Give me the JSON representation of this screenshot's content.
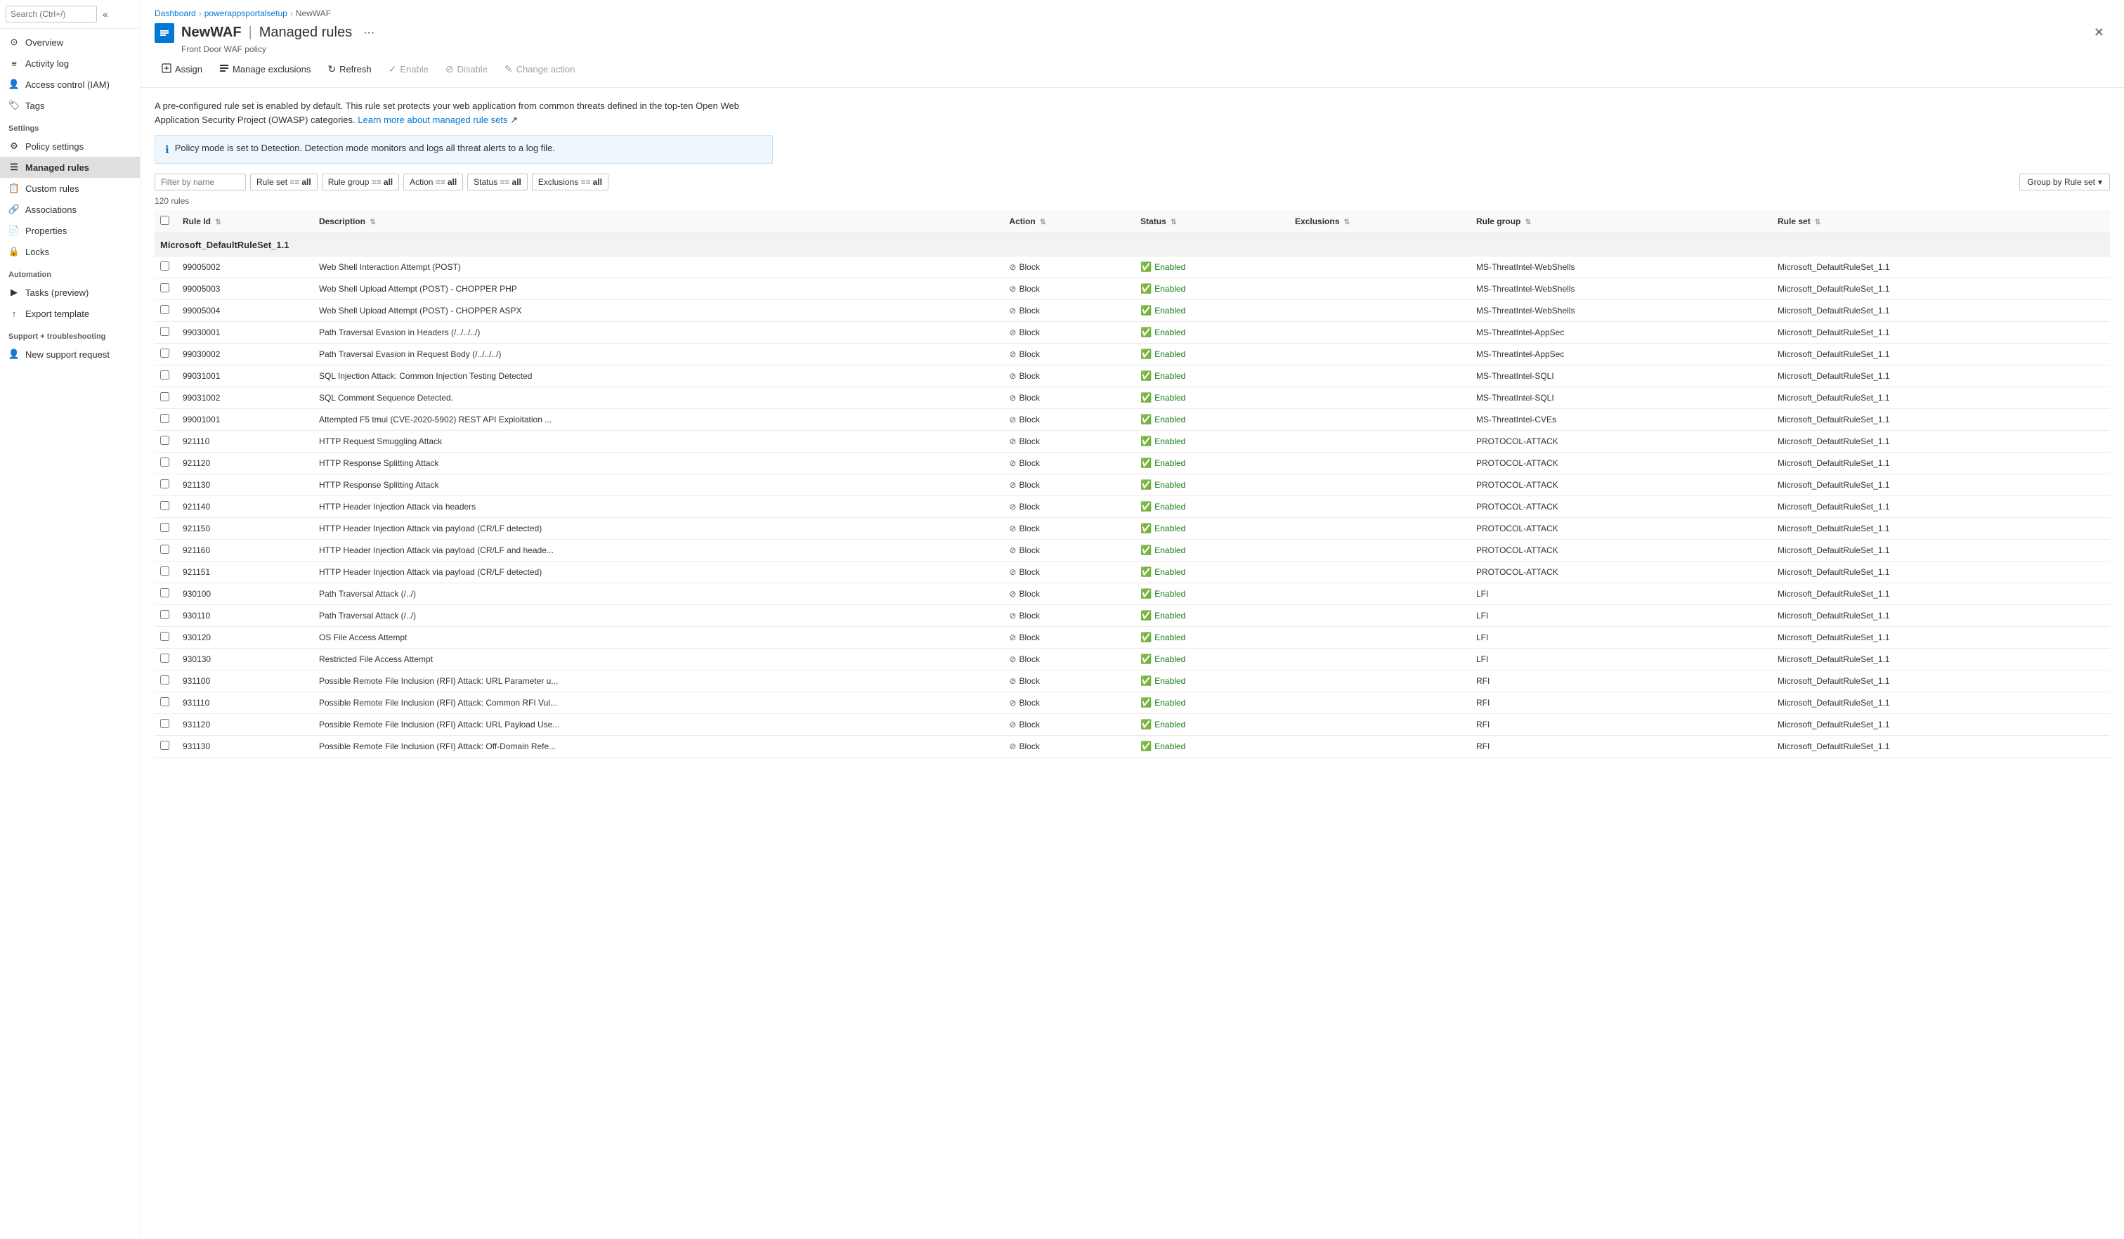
{
  "breadcrumb": {
    "items": [
      {
        "label": "Dashboard",
        "href": "#"
      },
      {
        "label": "powerappsportalsetup",
        "href": "#"
      },
      {
        "label": "NewWAF",
        "href": "#"
      }
    ]
  },
  "page": {
    "title": "NewWAF",
    "separator": "|",
    "subtitle": "Managed rules",
    "meta": "Front Door WAF policy",
    "more_btn_label": "···"
  },
  "toolbar": {
    "assign_label": "Assign",
    "manage_exclusions_label": "Manage exclusions",
    "refresh_label": "Refresh",
    "enable_label": "Enable",
    "disable_label": "Disable",
    "change_action_label": "Change action"
  },
  "info_text": "A pre-configured rule set is enabled by default. This rule set protects your web application from common threats defined in the top-ten Open Web Application Security Project (OWASP) categories.",
  "info_link_text": "Learn more about managed rule sets",
  "info_banner_text": "Policy mode is set to Detection. Detection mode monitors and logs all threat alerts to a log file.",
  "filters": {
    "filter_placeholder": "Filter by name",
    "rule_set_label": "Rule set == ",
    "rule_set_value": "all",
    "rule_group_label": "Rule group == ",
    "rule_group_value": "all",
    "action_label": "Action == ",
    "action_value": "all",
    "status_label": "Status == ",
    "status_value": "all",
    "exclusions_label": "Exclusions == ",
    "exclusions_value": "all",
    "group_by_label": "Group by Rule set"
  },
  "rules_count": "120 rules",
  "table": {
    "columns": [
      {
        "label": "Rule Id",
        "key": "rule_id"
      },
      {
        "label": "Description",
        "key": "description"
      },
      {
        "label": "Action",
        "key": "action"
      },
      {
        "label": "Status",
        "key": "status"
      },
      {
        "label": "Exclusions",
        "key": "exclusions"
      },
      {
        "label": "Rule group",
        "key": "rule_group"
      },
      {
        "label": "Rule set",
        "key": "rule_set"
      }
    ],
    "group_header": "Microsoft_DefaultRuleSet_1.1",
    "rows": [
      {
        "rule_id": "99005002",
        "description": "Web Shell Interaction Attempt (POST)",
        "action": "Block",
        "status": "Enabled",
        "exclusions": "",
        "rule_group": "MS-ThreatIntel-WebShells",
        "rule_set": "Microsoft_DefaultRuleSet_1.1"
      },
      {
        "rule_id": "99005003",
        "description": "Web Shell Upload Attempt (POST) - CHOPPER PHP",
        "action": "Block",
        "status": "Enabled",
        "exclusions": "",
        "rule_group": "MS-ThreatIntel-WebShells",
        "rule_set": "Microsoft_DefaultRuleSet_1.1"
      },
      {
        "rule_id": "99005004",
        "description": "Web Shell Upload Attempt (POST) - CHOPPER ASPX",
        "action": "Block",
        "status": "Enabled",
        "exclusions": "",
        "rule_group": "MS-ThreatIntel-WebShells",
        "rule_set": "Microsoft_DefaultRuleSet_1.1"
      },
      {
        "rule_id": "99030001",
        "description": "Path Traversal Evasion in Headers (/../../../)",
        "action": "Block",
        "status": "Enabled",
        "exclusions": "",
        "rule_group": "MS-ThreatIntel-AppSec",
        "rule_set": "Microsoft_DefaultRuleSet_1.1"
      },
      {
        "rule_id": "99030002",
        "description": "Path Traversal Evasion in Request Body (/../../../)",
        "action": "Block",
        "status": "Enabled",
        "exclusions": "",
        "rule_group": "MS-ThreatIntel-AppSec",
        "rule_set": "Microsoft_DefaultRuleSet_1.1"
      },
      {
        "rule_id": "99031001",
        "description": "SQL Injection Attack: Common Injection Testing Detected",
        "action": "Block",
        "status": "Enabled",
        "exclusions": "",
        "rule_group": "MS-ThreatIntel-SQLI",
        "rule_set": "Microsoft_DefaultRuleSet_1.1"
      },
      {
        "rule_id": "99031002",
        "description": "SQL Comment Sequence Detected.",
        "action": "Block",
        "status": "Enabled",
        "exclusions": "",
        "rule_group": "MS-ThreatIntel-SQLI",
        "rule_set": "Microsoft_DefaultRuleSet_1.1"
      },
      {
        "rule_id": "99001001",
        "description": "Attempted F5 tmui (CVE-2020-5902) REST API Exploitation ...",
        "action": "Block",
        "status": "Enabled",
        "exclusions": "",
        "rule_group": "MS-ThreatIntel-CVEs",
        "rule_set": "Microsoft_DefaultRuleSet_1.1"
      },
      {
        "rule_id": "921110",
        "description": "HTTP Request Smuggling Attack",
        "action": "Block",
        "status": "Enabled",
        "exclusions": "",
        "rule_group": "PROTOCOL-ATTACK",
        "rule_set": "Microsoft_DefaultRuleSet_1.1"
      },
      {
        "rule_id": "921120",
        "description": "HTTP Response Splitting Attack",
        "action": "Block",
        "status": "Enabled",
        "exclusions": "",
        "rule_group": "PROTOCOL-ATTACK",
        "rule_set": "Microsoft_DefaultRuleSet_1.1"
      },
      {
        "rule_id": "921130",
        "description": "HTTP Response Splitting Attack",
        "action": "Block",
        "status": "Enabled",
        "exclusions": "",
        "rule_group": "PROTOCOL-ATTACK",
        "rule_set": "Microsoft_DefaultRuleSet_1.1"
      },
      {
        "rule_id": "921140",
        "description": "HTTP Header Injection Attack via headers",
        "action": "Block",
        "status": "Enabled",
        "exclusions": "",
        "rule_group": "PROTOCOL-ATTACK",
        "rule_set": "Microsoft_DefaultRuleSet_1.1"
      },
      {
        "rule_id": "921150",
        "description": "HTTP Header Injection Attack via payload (CR/LF detected)",
        "action": "Block",
        "status": "Enabled",
        "exclusions": "",
        "rule_group": "PROTOCOL-ATTACK",
        "rule_set": "Microsoft_DefaultRuleSet_1.1"
      },
      {
        "rule_id": "921160",
        "description": "HTTP Header Injection Attack via payload (CR/LF and heade...",
        "action": "Block",
        "status": "Enabled",
        "exclusions": "",
        "rule_group": "PROTOCOL-ATTACK",
        "rule_set": "Microsoft_DefaultRuleSet_1.1"
      },
      {
        "rule_id": "921151",
        "description": "HTTP Header Injection Attack via payload (CR/LF detected)",
        "action": "Block",
        "status": "Enabled",
        "exclusions": "",
        "rule_group": "PROTOCOL-ATTACK",
        "rule_set": "Microsoft_DefaultRuleSet_1.1"
      },
      {
        "rule_id": "930100",
        "description": "Path Traversal Attack (/../)",
        "action": "Block",
        "status": "Enabled",
        "exclusions": "",
        "rule_group": "LFI",
        "rule_set": "Microsoft_DefaultRuleSet_1.1"
      },
      {
        "rule_id": "930110",
        "description": "Path Traversal Attack (/../)",
        "action": "Block",
        "status": "Enabled",
        "exclusions": "",
        "rule_group": "LFI",
        "rule_set": "Microsoft_DefaultRuleSet_1.1"
      },
      {
        "rule_id": "930120",
        "description": "OS File Access Attempt",
        "action": "Block",
        "status": "Enabled",
        "exclusions": "",
        "rule_group": "LFI",
        "rule_set": "Microsoft_DefaultRuleSet_1.1"
      },
      {
        "rule_id": "930130",
        "description": "Restricted File Access Attempt",
        "action": "Block",
        "status": "Enabled",
        "exclusions": "",
        "rule_group": "LFI",
        "rule_set": "Microsoft_DefaultRuleSet_1.1"
      },
      {
        "rule_id": "931100",
        "description": "Possible Remote File Inclusion (RFI) Attack: URL Parameter u...",
        "action": "Block",
        "status": "Enabled",
        "exclusions": "",
        "rule_group": "RFI",
        "rule_set": "Microsoft_DefaultRuleSet_1.1"
      },
      {
        "rule_id": "931110",
        "description": "Possible Remote File Inclusion (RFI) Attack: Common RFI Vul...",
        "action": "Block",
        "status": "Enabled",
        "exclusions": "",
        "rule_group": "RFI",
        "rule_set": "Microsoft_DefaultRuleSet_1.1"
      },
      {
        "rule_id": "931120",
        "description": "Possible Remote File Inclusion (RFI) Attack: URL Payload Use...",
        "action": "Block",
        "status": "Enabled",
        "exclusions": "",
        "rule_group": "RFI",
        "rule_set": "Microsoft_DefaultRuleSet_1.1"
      },
      {
        "rule_id": "931130",
        "description": "Possible Remote File Inclusion (RFI) Attack: Off-Domain Refe...",
        "action": "Block",
        "status": "Enabled",
        "exclusions": "",
        "rule_group": "RFI",
        "rule_set": "Microsoft_DefaultRuleSet_1.1"
      }
    ]
  },
  "sidebar": {
    "search_placeholder": "Search (Ctrl+/)",
    "collapse_icon": "«",
    "nav_items": [
      {
        "label": "Overview",
        "icon": "⊙",
        "id": "overview"
      },
      {
        "label": "Activity log",
        "icon": "≡",
        "id": "activity-log"
      },
      {
        "label": "Access control (IAM)",
        "icon": "👤",
        "id": "access-control"
      },
      {
        "label": "Tags",
        "icon": "🏷",
        "id": "tags"
      }
    ],
    "settings_label": "Settings",
    "settings_items": [
      {
        "label": "Policy settings",
        "icon": "⚙",
        "id": "policy-settings"
      },
      {
        "label": "Managed rules",
        "icon": "☰",
        "id": "managed-rules",
        "active": true
      },
      {
        "label": "Custom rules",
        "icon": "📋",
        "id": "custom-rules"
      },
      {
        "label": "Associations",
        "icon": "🔗",
        "id": "associations"
      },
      {
        "label": "Properties",
        "icon": "📄",
        "id": "properties"
      },
      {
        "label": "Locks",
        "icon": "🔒",
        "id": "locks"
      }
    ],
    "automation_label": "Automation",
    "automation_items": [
      {
        "label": "Tasks (preview)",
        "icon": "▶",
        "id": "tasks"
      },
      {
        "label": "Export template",
        "icon": "↑",
        "id": "export-template"
      }
    ],
    "support_label": "Support + troubleshooting",
    "support_items": [
      {
        "label": "New support request",
        "icon": "👤",
        "id": "new-support"
      }
    ]
  }
}
